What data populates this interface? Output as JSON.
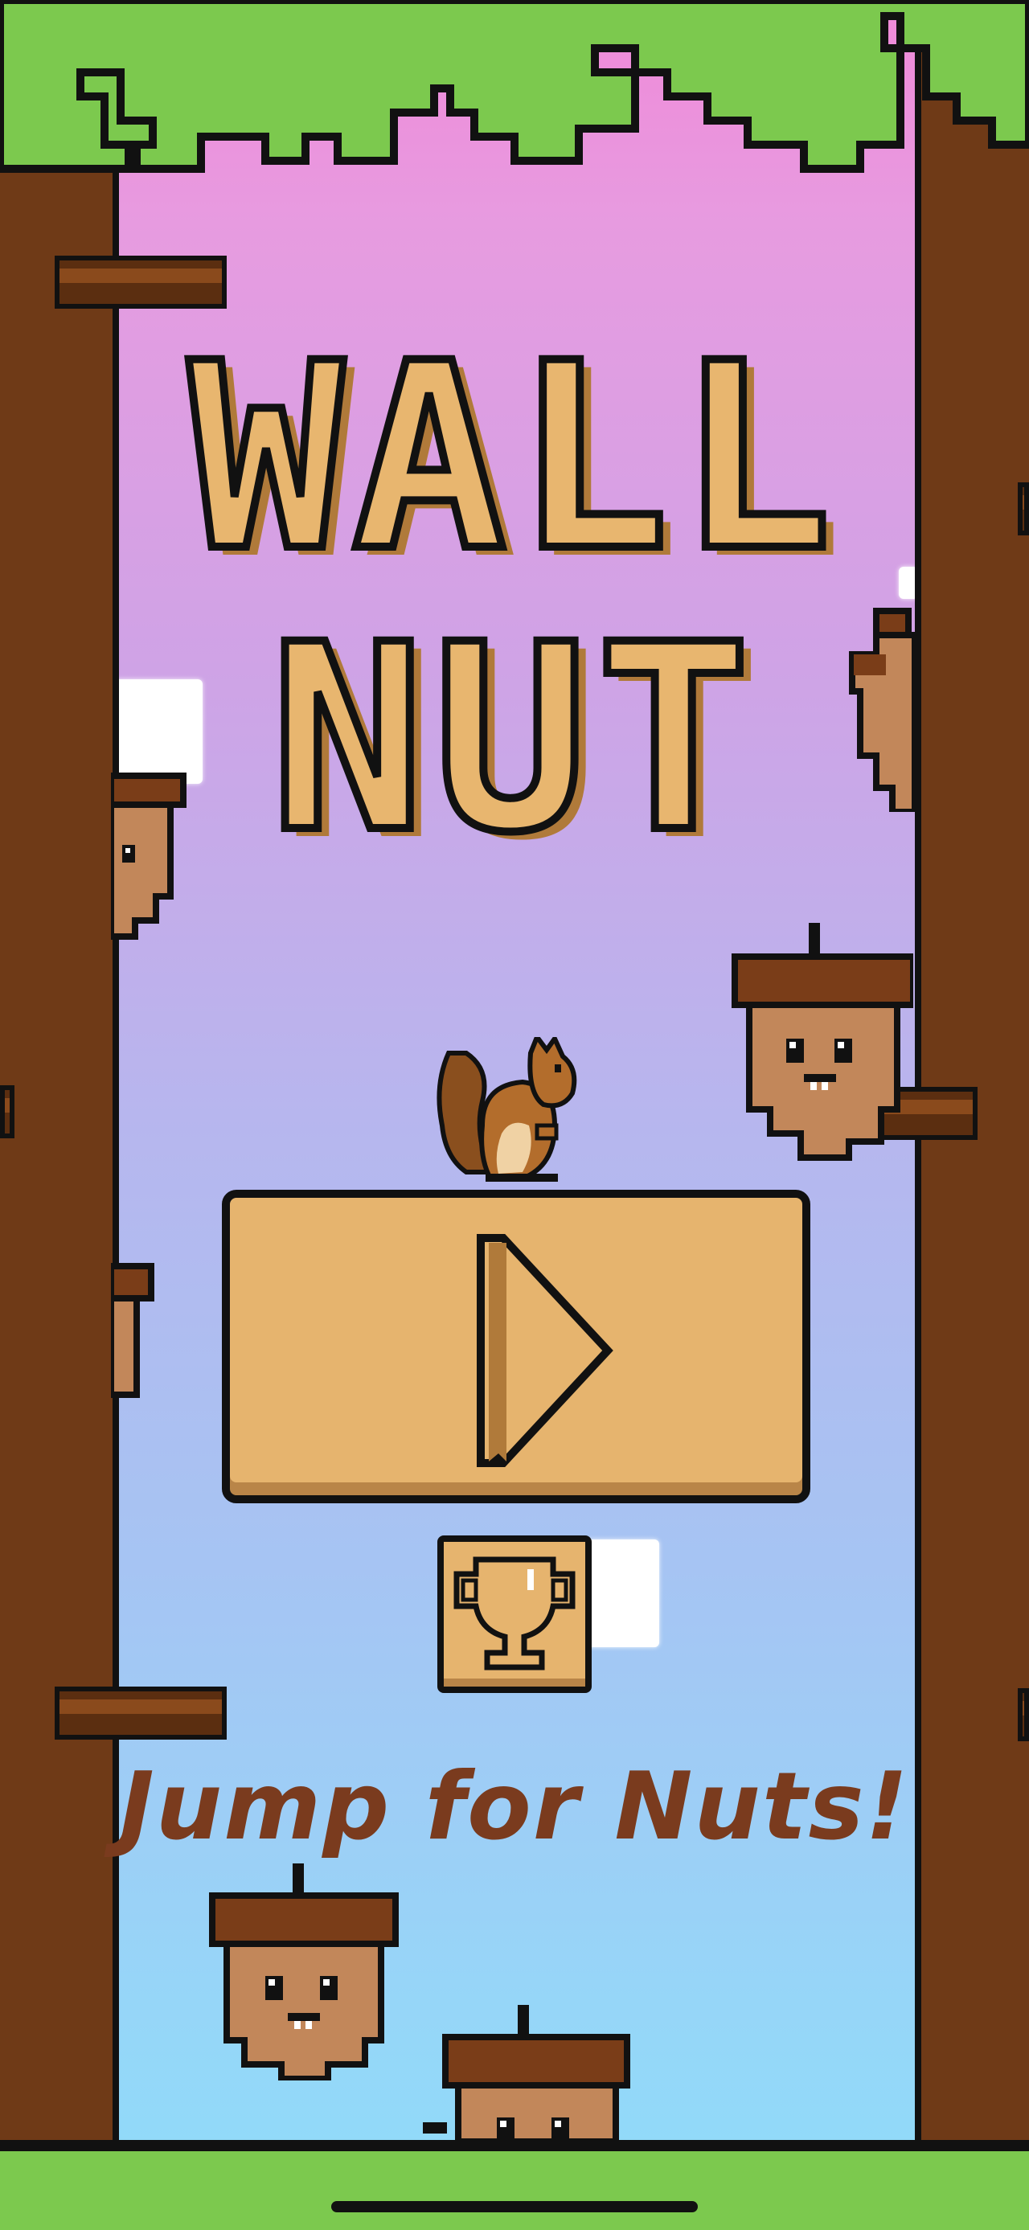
{
  "game": {
    "title_line1": "WALL",
    "title_line2": "NUT",
    "tagline": "Jump for Nuts!"
  },
  "buttons": {
    "play_icon": "play-icon",
    "leaderboard_icon": "trophy-icon"
  },
  "colors": {
    "grass": "#7cc94e",
    "trunk": "#6f3a17",
    "button": "#e6b46e",
    "tagline": "#7a3b1e",
    "outline": "#111111"
  }
}
